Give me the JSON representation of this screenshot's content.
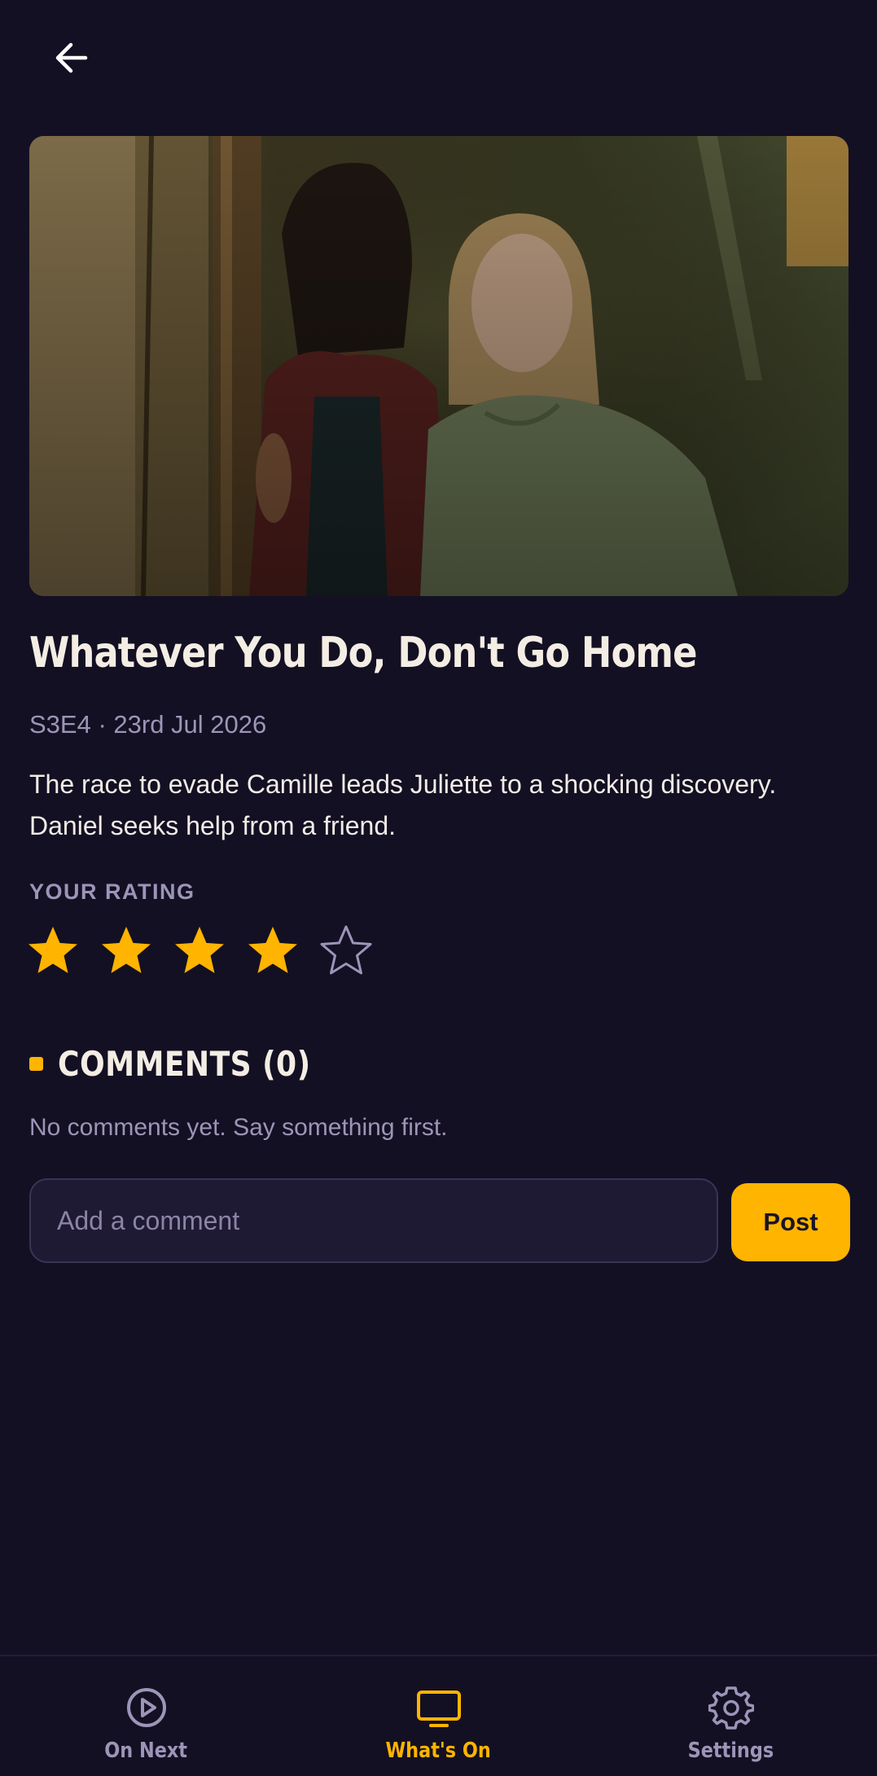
{
  "header": {
    "back_icon": "arrow-left-icon"
  },
  "episode": {
    "title": "Whatever You Do, Don't Go Home",
    "meta": "S3E4 · 23rd Jul 2026",
    "description": "The race to evade Camille leads Juliette to a shocking discovery. Daniel seeks help from a friend."
  },
  "rating": {
    "label": "YOUR RATING",
    "value": 4,
    "max": 5,
    "filled_color": "#ffb400",
    "empty_color": "#9d95b8"
  },
  "comments": {
    "title": "COMMENTS (0)",
    "empty_message": "No comments yet. Say something first.",
    "input_placeholder": "Add a comment",
    "input_value": "",
    "post_label": "Post"
  },
  "nav": {
    "items": [
      {
        "label": "On Next",
        "icon": "play-circle-icon",
        "active": false
      },
      {
        "label": "What's On",
        "icon": "tv-icon",
        "active": true
      },
      {
        "label": "Settings",
        "icon": "gear-icon",
        "active": false
      }
    ]
  },
  "colors": {
    "background": "#141023",
    "accent": "#ffb400",
    "muted_text": "#9d95b8"
  }
}
